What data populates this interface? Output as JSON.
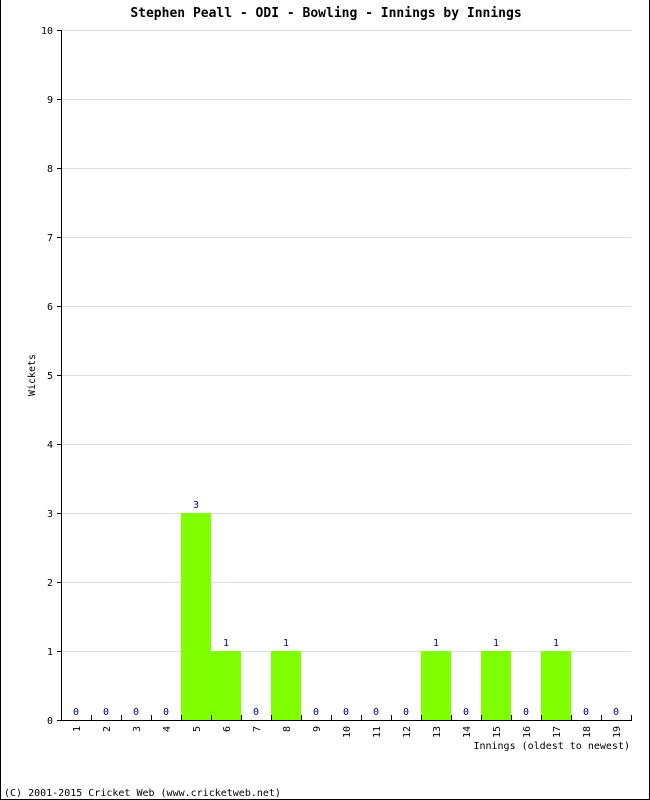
{
  "chart_data": {
    "type": "bar",
    "title": "Stephen Peall - ODI - Bowling - Innings by Innings",
    "xlabel": "Innings (oldest to newest)",
    "ylabel": "Wickets",
    "ylim": [
      0,
      10
    ],
    "yticks": [
      0,
      1,
      2,
      3,
      4,
      5,
      6,
      7,
      8,
      9,
      10
    ],
    "grid": true,
    "categories": [
      "1",
      "2",
      "3",
      "4",
      "5",
      "6",
      "7",
      "8",
      "9",
      "10",
      "11",
      "12",
      "13",
      "14",
      "15",
      "16",
      "17",
      "18",
      "19"
    ],
    "values": [
      0,
      0,
      0,
      0,
      3,
      1,
      0,
      1,
      0,
      0,
      0,
      0,
      1,
      0,
      1,
      0,
      1,
      0,
      0
    ],
    "bar_color": "#80FF00",
    "label_color": "#000080",
    "grid_color": "#DDDDDD"
  },
  "footer": {
    "copyright": "(C) 2001-2015 Cricket Web (www.cricketweb.net)"
  }
}
